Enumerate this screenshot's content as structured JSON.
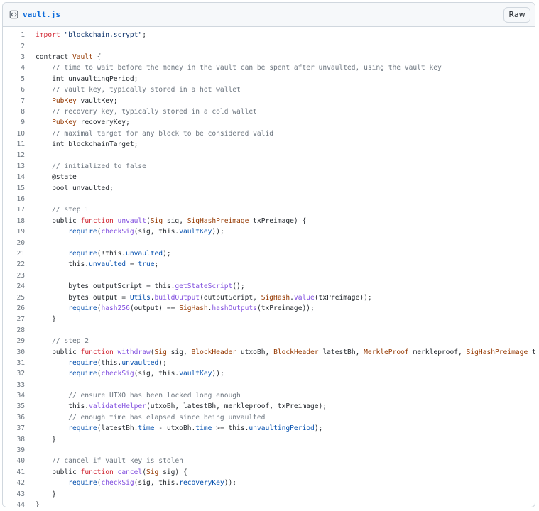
{
  "file": {
    "name": "vault.js",
    "icon": "code-file-icon",
    "raw_label": "Raw"
  },
  "colors": {
    "comment": "#6e7781",
    "keyword": "#cf222e",
    "type": "#953800",
    "function": "#8250df",
    "property": "#0550ae",
    "string": "#0a3069",
    "plain": "#24292f"
  },
  "lines": [
    [
      [
        "kw",
        "import"
      ],
      [
        "p",
        " "
      ],
      [
        "str",
        "\"blockchain.scrypt\""
      ],
      [
        "p",
        ";"
      ]
    ],
    [],
    [
      [
        "p",
        "contract "
      ],
      [
        "type",
        "Vault"
      ],
      [
        "p",
        " {"
      ]
    ],
    [
      [
        "c",
        "    // time to wait before the money in the vault can be spent after unvaulted, using the vault key"
      ]
    ],
    [
      [
        "p",
        "    int unvaultingPeriod;"
      ]
    ],
    [
      [
        "c",
        "    // vault key, typically stored in a hot wallet"
      ]
    ],
    [
      [
        "p",
        "    "
      ],
      [
        "type",
        "PubKey"
      ],
      [
        "p",
        " vaultKey;"
      ]
    ],
    [
      [
        "c",
        "    // recovery key, typically stored in a cold wallet"
      ]
    ],
    [
      [
        "p",
        "    "
      ],
      [
        "type",
        "PubKey"
      ],
      [
        "p",
        " recoveryKey;"
      ]
    ],
    [
      [
        "c",
        "    // maximal target for any block to be considered valid"
      ]
    ],
    [
      [
        "p",
        "    int blockchainTarget;"
      ]
    ],
    [],
    [
      [
        "c",
        "    // initialized to false"
      ]
    ],
    [
      [
        "p",
        "    @state"
      ]
    ],
    [
      [
        "p",
        "    bool unvaulted;"
      ]
    ],
    [],
    [
      [
        "c",
        "    // step 1"
      ]
    ],
    [
      [
        "p",
        "    public "
      ],
      [
        "kw",
        "function"
      ],
      [
        "p",
        " "
      ],
      [
        "fn",
        "unvault"
      ],
      [
        "p",
        "("
      ],
      [
        "type",
        "Sig"
      ],
      [
        "p",
        " sig, "
      ],
      [
        "type",
        "SigHashPreimage"
      ],
      [
        "p",
        " txPreimage) {"
      ]
    ],
    [
      [
        "p",
        "        "
      ],
      [
        "prop",
        "require"
      ],
      [
        "p",
        "("
      ],
      [
        "fn",
        "checkSig"
      ],
      [
        "p",
        "(sig, this."
      ],
      [
        "prop",
        "vaultKey"
      ],
      [
        "p",
        "));"
      ]
    ],
    [],
    [
      [
        "p",
        "        "
      ],
      [
        "prop",
        "require"
      ],
      [
        "p",
        "(!this."
      ],
      [
        "prop",
        "unvaulted"
      ],
      [
        "p",
        ");"
      ]
    ],
    [
      [
        "p",
        "        this."
      ],
      [
        "prop",
        "unvaulted"
      ],
      [
        "p",
        " = "
      ],
      [
        "prop",
        "true"
      ],
      [
        "p",
        ";"
      ]
    ],
    [],
    [
      [
        "p",
        "        bytes outputScript = this."
      ],
      [
        "fn",
        "getStateScript"
      ],
      [
        "p",
        "();"
      ]
    ],
    [
      [
        "p",
        "        bytes output = "
      ],
      [
        "prop",
        "Utils"
      ],
      [
        "p",
        "."
      ],
      [
        "fn",
        "buildOutput"
      ],
      [
        "p",
        "(outputScript, "
      ],
      [
        "type",
        "SigHash"
      ],
      [
        "p",
        "."
      ],
      [
        "fn",
        "value"
      ],
      [
        "p",
        "(txPreimage));"
      ]
    ],
    [
      [
        "p",
        "        "
      ],
      [
        "prop",
        "require"
      ],
      [
        "p",
        "("
      ],
      [
        "fn",
        "hash256"
      ],
      [
        "p",
        "(output) == "
      ],
      [
        "type",
        "SigHash"
      ],
      [
        "p",
        "."
      ],
      [
        "fn",
        "hashOutputs"
      ],
      [
        "p",
        "(txPreimage));"
      ]
    ],
    [
      [
        "p",
        "    }"
      ]
    ],
    [],
    [
      [
        "c",
        "    // step 2"
      ]
    ],
    [
      [
        "p",
        "    public "
      ],
      [
        "kw",
        "function"
      ],
      [
        "p",
        " "
      ],
      [
        "fn",
        "withdraw"
      ],
      [
        "p",
        "("
      ],
      [
        "type",
        "Sig"
      ],
      [
        "p",
        " sig, "
      ],
      [
        "type",
        "BlockHeader"
      ],
      [
        "p",
        " utxoBh, "
      ],
      [
        "type",
        "BlockHeader"
      ],
      [
        "p",
        " latestBh, "
      ],
      [
        "type",
        "MerkleProof"
      ],
      [
        "p",
        " merkleproof, "
      ],
      [
        "type",
        "SigHashPreimage"
      ],
      [
        "p",
        " txPreimage) {"
      ]
    ],
    [
      [
        "p",
        "        "
      ],
      [
        "prop",
        "require"
      ],
      [
        "p",
        "(this."
      ],
      [
        "prop",
        "unvaulted"
      ],
      [
        "p",
        ");"
      ]
    ],
    [
      [
        "p",
        "        "
      ],
      [
        "prop",
        "require"
      ],
      [
        "p",
        "("
      ],
      [
        "fn",
        "checkSig"
      ],
      [
        "p",
        "(sig, this."
      ],
      [
        "prop",
        "vaultKey"
      ],
      [
        "p",
        "));"
      ]
    ],
    [],
    [
      [
        "c",
        "        // ensure UTXO has been locked long enough"
      ]
    ],
    [
      [
        "p",
        "        this."
      ],
      [
        "fn",
        "validateHelper"
      ],
      [
        "p",
        "(utxoBh, latestBh, merkleproof, txPreimage);"
      ]
    ],
    [
      [
        "c",
        "        // enough time has elapsed since being unvaulted"
      ]
    ],
    [
      [
        "p",
        "        "
      ],
      [
        "prop",
        "require"
      ],
      [
        "p",
        "(latestBh."
      ],
      [
        "prop",
        "time"
      ],
      [
        "p",
        " - utxoBh."
      ],
      [
        "prop",
        "time"
      ],
      [
        "p",
        " >= this."
      ],
      [
        "prop",
        "unvaultingPeriod"
      ],
      [
        "p",
        ");"
      ]
    ],
    [
      [
        "p",
        "    }"
      ]
    ],
    [],
    [
      [
        "c",
        "    // cancel if vault key is stolen"
      ]
    ],
    [
      [
        "p",
        "    public "
      ],
      [
        "kw",
        "function"
      ],
      [
        "p",
        " "
      ],
      [
        "fn",
        "cancel"
      ],
      [
        "p",
        "("
      ],
      [
        "type",
        "Sig"
      ],
      [
        "p",
        " sig) {"
      ]
    ],
    [
      [
        "p",
        "        "
      ],
      [
        "prop",
        "require"
      ],
      [
        "p",
        "("
      ],
      [
        "fn",
        "checkSig"
      ],
      [
        "p",
        "(sig, this."
      ],
      [
        "prop",
        "recoveryKey"
      ],
      [
        "p",
        "));"
      ]
    ],
    [
      [
        "p",
        "    }"
      ]
    ],
    [
      [
        "p",
        "}"
      ]
    ]
  ]
}
